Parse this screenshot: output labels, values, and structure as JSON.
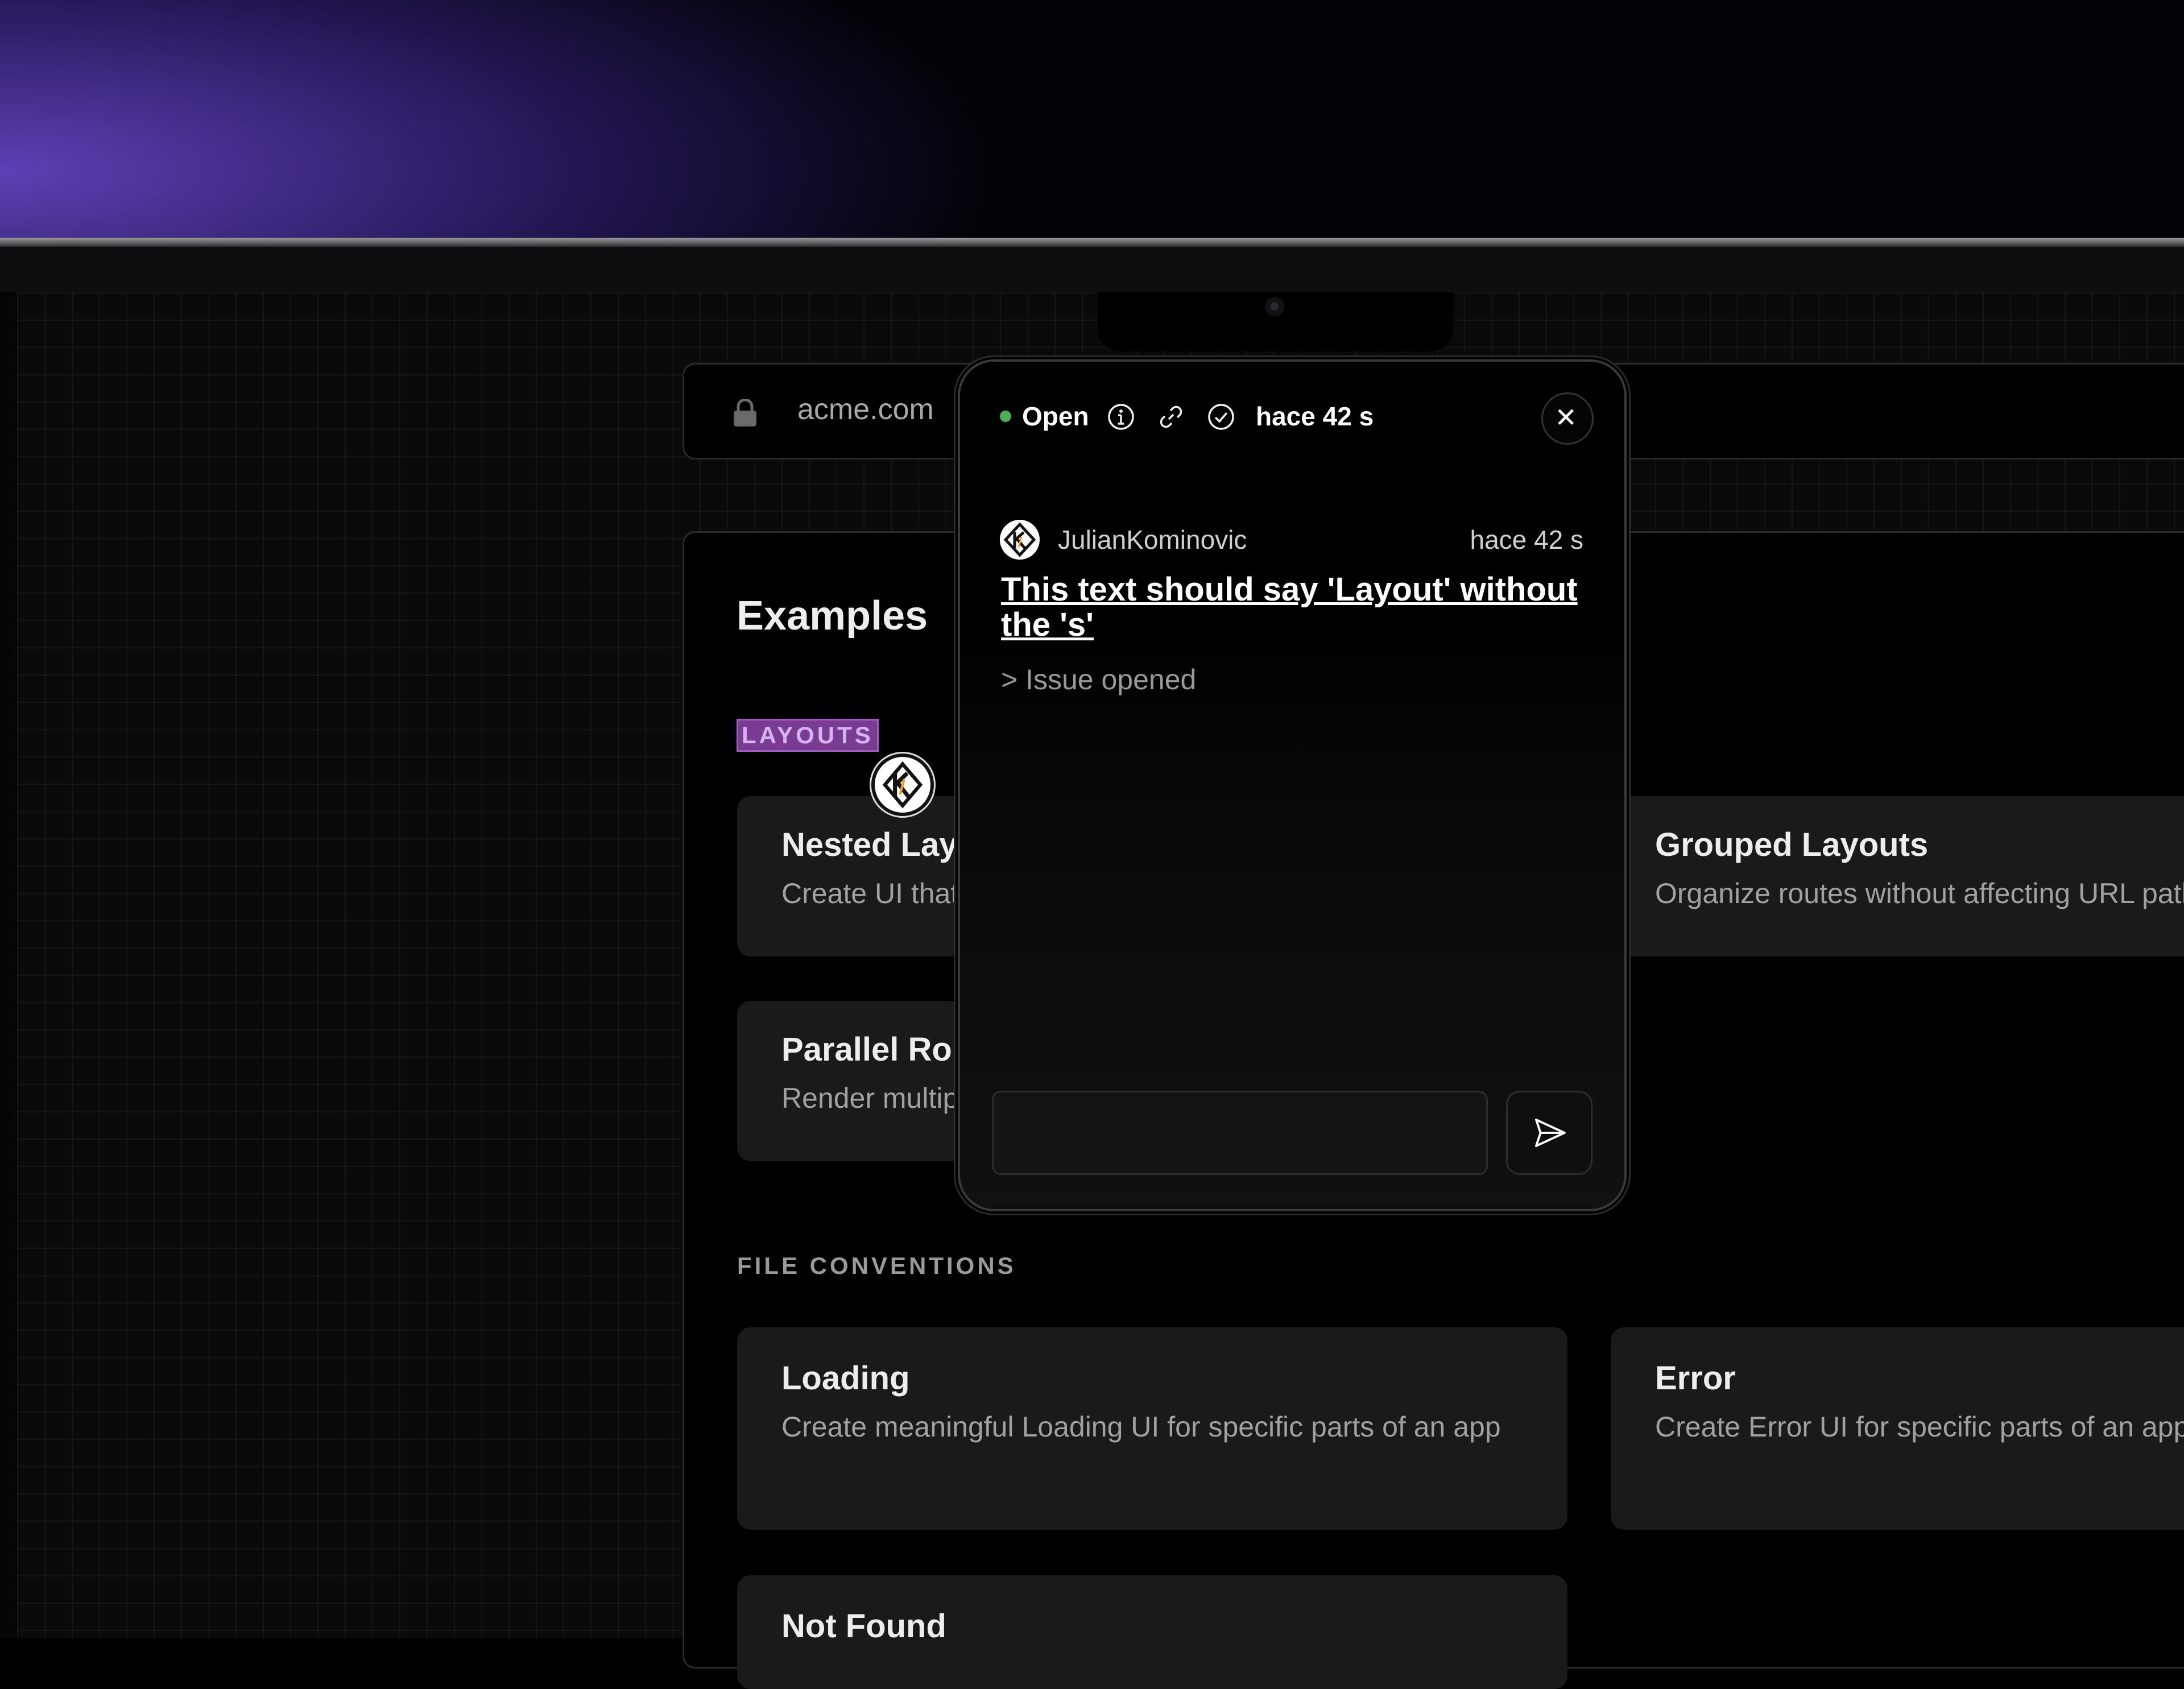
{
  "browser": {
    "url": "acme.com"
  },
  "page": {
    "title": "Examples",
    "layouts_label": "LAYOUTS",
    "file_conventions_label": "FILE CONVENTIONS",
    "layout_cards": [
      {
        "title": "Nested Layouts",
        "description": "Create UI that is shared across routes"
      },
      {
        "title": "Grouped Layouts",
        "description": "Organize routes without affecting URL paths"
      },
      {
        "title": "Parallel Routes",
        "description": "Render multiple pages in the same layout"
      }
    ],
    "convention_cards": [
      {
        "title": "Loading",
        "description": "Create meaningful Loading UI for specific parts of an app"
      },
      {
        "title": "Error",
        "description": "Create Error UI for specific parts of an app"
      },
      {
        "title": "Not Found",
        "description": ""
      }
    ]
  },
  "comment_popup": {
    "status": "Open",
    "time": "hace 42 s",
    "icons": [
      "info-icon",
      "link-icon",
      "check-circle-icon",
      "close-icon",
      "send-icon"
    ],
    "comment": {
      "author": "JulianKominovic",
      "time": "hace 42 s",
      "text": "This text should say 'Layout' without the 's'",
      "note": "> Issue opened"
    },
    "reply_placeholder": ""
  },
  "colors": {
    "status_open": "#4caf50",
    "highlight": "#7a3c92",
    "card_bg": "#1a1a1a"
  }
}
